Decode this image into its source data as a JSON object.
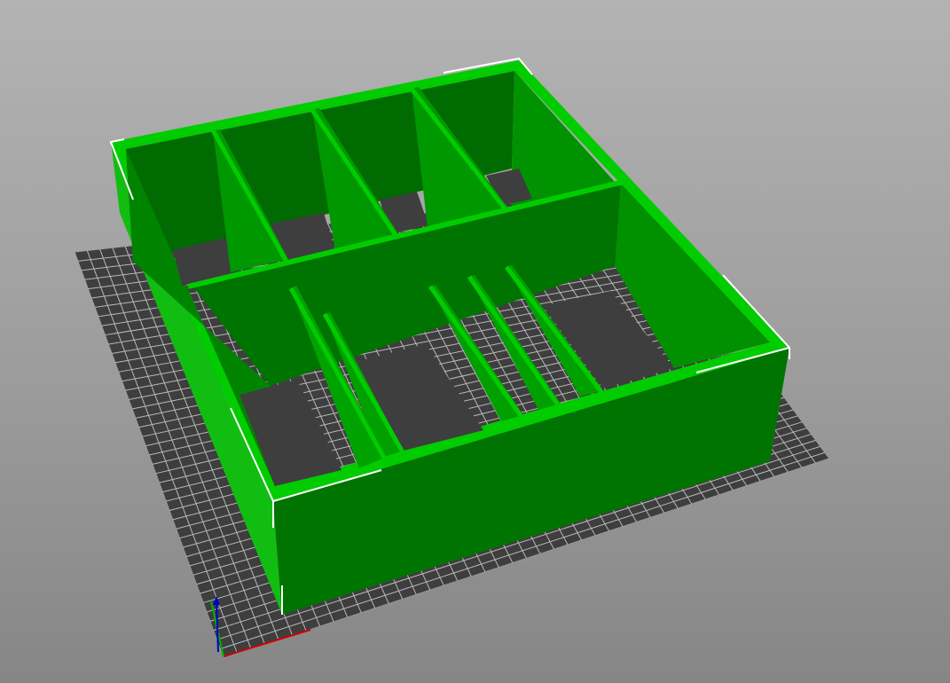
{
  "view": {
    "type": "3d-printer-preview",
    "model": "compartment-tray",
    "colors": {
      "background_top": "#b3b3b3",
      "background_bottom": "#868686",
      "bed": "#3e3e3e",
      "bed_grid": "#b9b9b9",
      "model_outer_wall": "#007400",
      "model_side_wall": "#12bd12",
      "model_top_edge": "#00cc00",
      "model_inner_wall": "#008a00",
      "model_divider": "#009800",
      "selection_edge": "#ffffff",
      "axis_x": "#d00000",
      "axis_y": "#00b000",
      "axis_z": "#0000c8"
    },
    "icons": {
      "axes": "xyz-axes-icon"
    }
  }
}
